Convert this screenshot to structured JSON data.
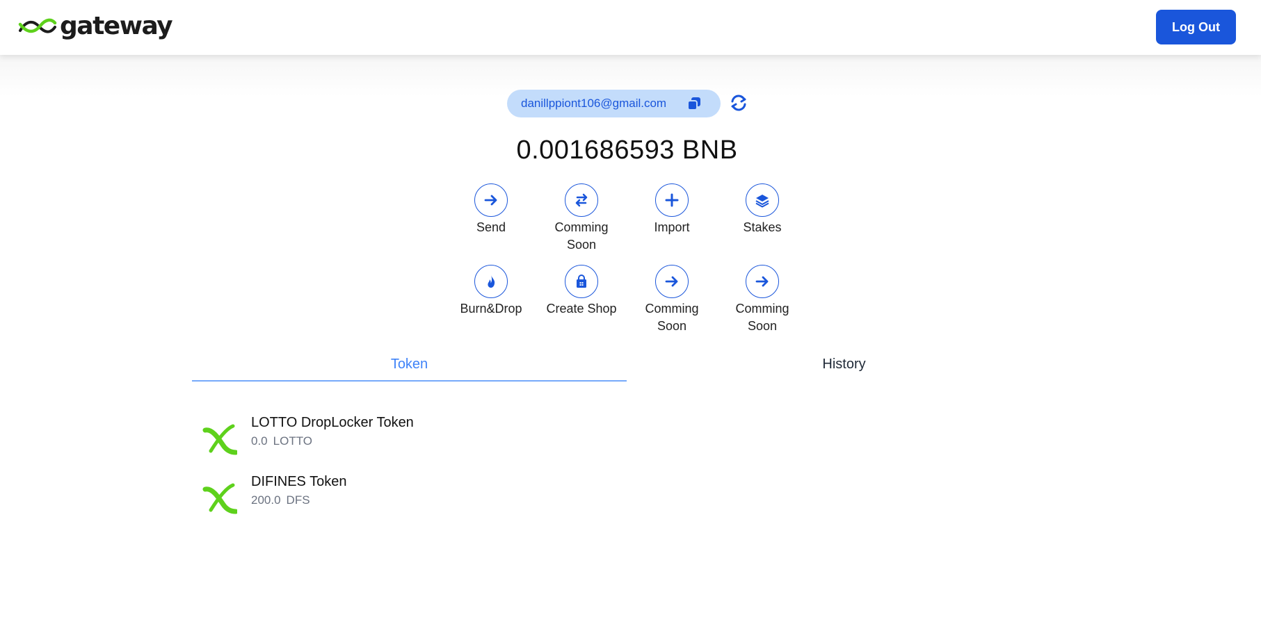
{
  "header": {
    "logo_text": "gateway",
    "logout_label": "Log Out"
  },
  "account": {
    "email": "danillppiont106@gmail.com",
    "balance": "0.001686593 BNB"
  },
  "actions": [
    {
      "label": "Send",
      "icon": "arrow-right-icon"
    },
    {
      "label": "Comming Soon",
      "icon": "swap-arrows-icon"
    },
    {
      "label": "Import",
      "icon": "plus-icon"
    },
    {
      "label": "Stakes",
      "icon": "layers-icon"
    },
    {
      "label": "Burn&Drop",
      "icon": "fire-icon"
    },
    {
      "label": "Create Shop",
      "icon": "shopping-bag-icon"
    },
    {
      "label": "Comming Soon",
      "icon": "arrow-right-icon"
    },
    {
      "label": "Comming Soon",
      "icon": "arrow-right-icon"
    }
  ],
  "tabs": [
    {
      "label": "Token",
      "active": true
    },
    {
      "label": "History",
      "active": false
    }
  ],
  "tokens": [
    {
      "name": "LOTTO DropLocker Token",
      "amount": "0.0",
      "symbol": "LOTTO"
    },
    {
      "name": "DIFINES Token",
      "amount": "200.0",
      "symbol": "DFS"
    }
  ],
  "colors": {
    "accent": "#1a56db",
    "accent_light": "#3f83f8",
    "pill_bg": "#c3dcfb",
    "logo_green": "#5ed11c"
  }
}
